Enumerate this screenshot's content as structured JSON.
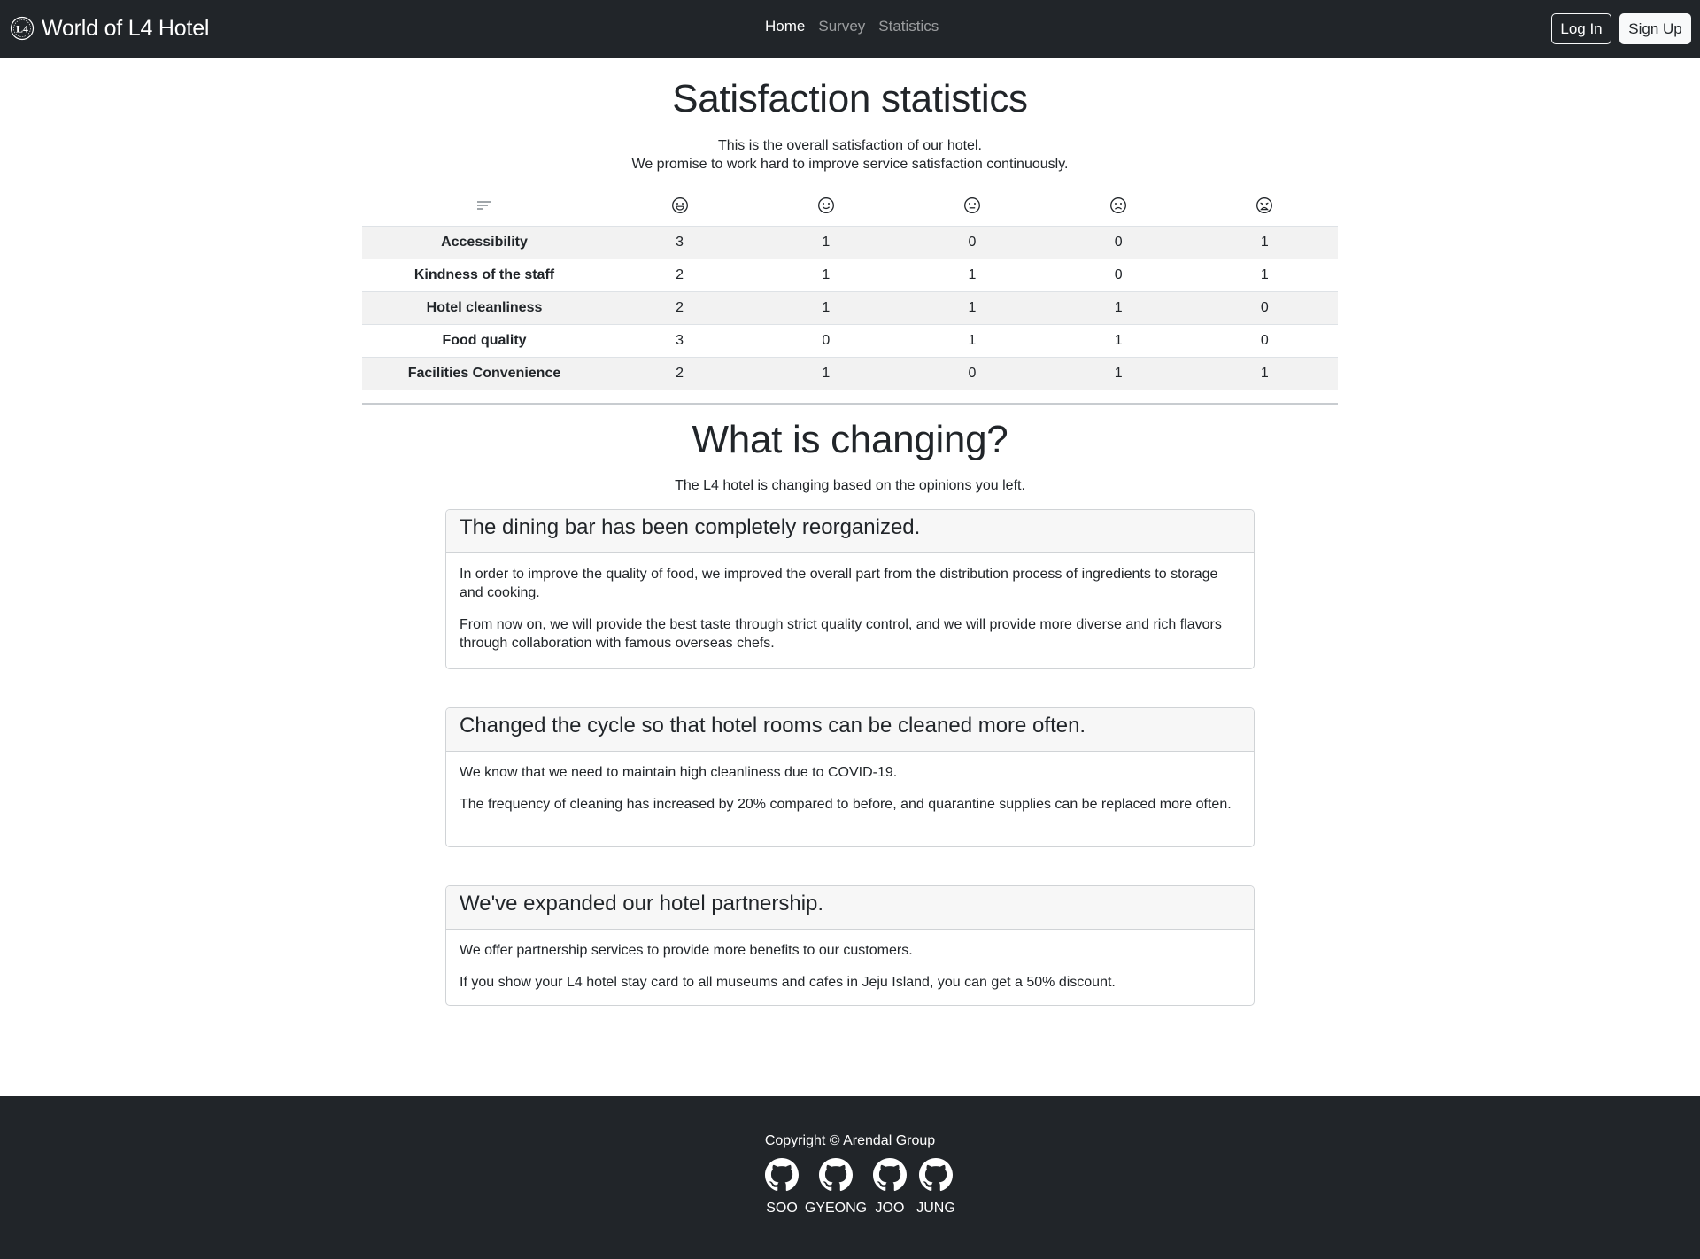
{
  "navbar": {
    "brand": "World of L4 Hotel",
    "brand_logo_icon": "hotel-emblem-icon",
    "links": [
      {
        "label": "Home",
        "active": true
      },
      {
        "label": "Survey",
        "active": false
      },
      {
        "label": "Statistics",
        "active": false
      }
    ],
    "login_label": "Log In",
    "signup_label": "Sign Up"
  },
  "stats": {
    "title": "Satisfaction statistics",
    "subtitle_line1": "This is the overall satisfaction of our hotel.",
    "subtitle_line2": "We promise to work hard to improve service satisfaction continuously.",
    "header_icons": [
      "sort-lines-icon",
      "very-satisfied-face-icon",
      "satisfied-face-icon",
      "neutral-face-icon",
      "dissatisfied-face-icon",
      "very-dissatisfied-face-icon"
    ],
    "rows": [
      {
        "label": "Accessibility",
        "values": [
          "3",
          "1",
          "0",
          "0",
          "1"
        ]
      },
      {
        "label": "Kindness of the staff",
        "values": [
          "2",
          "1",
          "1",
          "0",
          "1"
        ]
      },
      {
        "label": "Hotel cleanliness",
        "values": [
          "2",
          "1",
          "1",
          "1",
          "0"
        ]
      },
      {
        "label": "Food quality",
        "values": [
          "3",
          "0",
          "1",
          "1",
          "0"
        ]
      },
      {
        "label": "Facilities Convenience",
        "values": [
          "2",
          "1",
          "0",
          "1",
          "1"
        ]
      }
    ]
  },
  "changes": {
    "title": "What is changing?",
    "subtitle": "The L4 hotel is changing based on the opinions you left.",
    "cards": [
      {
        "header": "The dining bar has been completely reorganized.",
        "paragraphs": [
          "In order to improve the quality of food, we improved the overall part from the distribution process of ingredients to storage and cooking.",
          "From now on, we will provide the best taste through strict quality control, and we will provide more diverse and rich flavors through collaboration with famous overseas chefs."
        ]
      },
      {
        "header": "Changed the cycle so that hotel rooms can be cleaned more often.",
        "paragraphs": [
          "We know that we need to maintain high cleanliness due to COVID-19.",
          "The frequency of cleaning has increased by 20% compared to before, and quarantine supplies can be replaced more often."
        ]
      },
      {
        "header": "We've expanded our hotel partnership.",
        "paragraphs": [
          "We offer partnership services to provide more benefits to our customers.",
          "If you show your L4 hotel stay card to all museums and cafes in Jeju Island, you can get a 50% discount."
        ]
      }
    ]
  },
  "footer": {
    "copyright": "Copyright © Arendal Group",
    "members": [
      {
        "name": "SOO",
        "icon": "github-icon"
      },
      {
        "name": "GYEONG",
        "icon": "github-icon"
      },
      {
        "name": "JOO",
        "icon": "github-icon"
      },
      {
        "name": "JUNG",
        "icon": "github-icon"
      }
    ]
  },
  "colors": {
    "navbar_bg": "#212529",
    "footer_bg": "#212529",
    "stripe_bg": "#f2f2f2",
    "card_header_bg": "#f7f7f7"
  }
}
